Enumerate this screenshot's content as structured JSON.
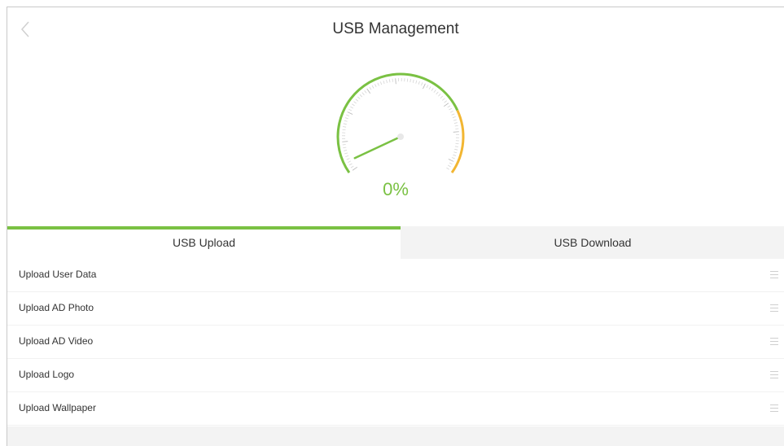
{
  "header": {
    "title": "USB Management",
    "back_icon": "chevron-left-icon"
  },
  "gauge": {
    "percent_text": "0%",
    "value": 0,
    "colors": {
      "green": "#7ac143",
      "yellow": "#f2b632",
      "needle": "#7ac143"
    }
  },
  "tabs": [
    {
      "label": "USB Upload",
      "active": true
    },
    {
      "label": "USB Download",
      "active": false
    }
  ],
  "list": {
    "items": [
      {
        "label": "Upload User Data",
        "icon": "drag-handle-icon"
      },
      {
        "label": "Upload AD Photo",
        "icon": "drag-handle-icon"
      },
      {
        "label": "Upload AD Video",
        "icon": "drag-handle-icon"
      },
      {
        "label": "Upload Logo",
        "icon": "drag-handle-icon"
      },
      {
        "label": "Upload Wallpaper",
        "icon": "drag-handle-icon"
      }
    ]
  },
  "colors": {
    "accent": "#7ac143",
    "tab_inactive_bg": "#f3f3f3",
    "text": "#333333"
  }
}
